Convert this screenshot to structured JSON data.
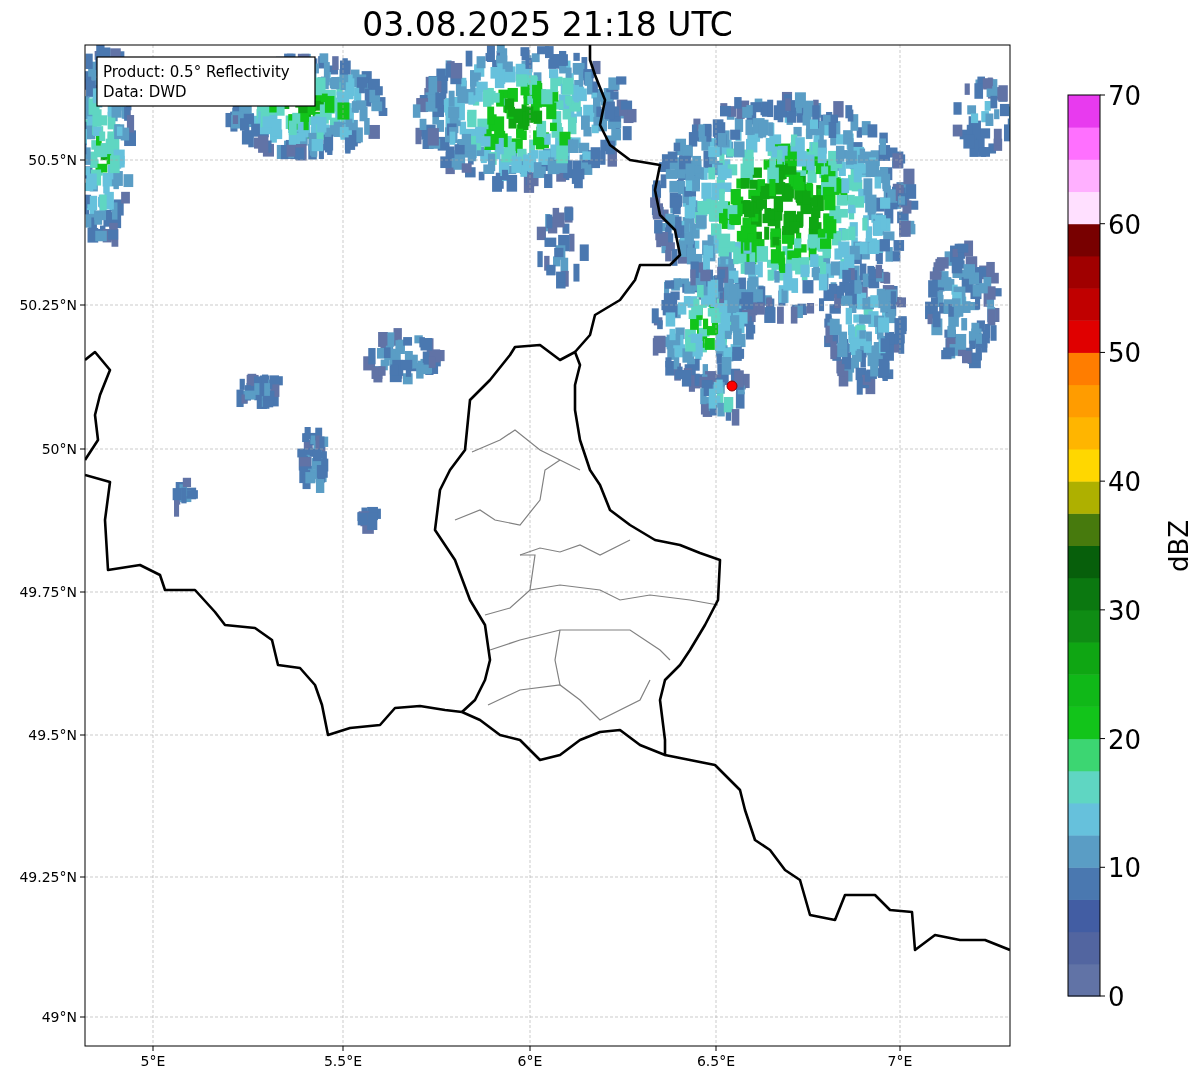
{
  "title": "03.08.2025 21:18 UTC",
  "info_box": [
    "Product: 0.5° Reflectivity",
    "Data: DWD"
  ],
  "lat_labels": [
    "50.5°N",
    "50.25°N",
    "50°N",
    "49.75°N",
    "49.5°N",
    "49.25°N",
    "49°N"
  ],
  "lon_labels": [
    "5°E",
    "5.5°E",
    "6°E",
    "6.5°E",
    "7°E"
  ],
  "colorbar": {
    "label": "dBZ",
    "ticks": [
      "70",
      "60",
      "50",
      "40",
      "30",
      "20",
      "10",
      "0"
    ],
    "segments": [
      {
        "color": "#6173a6"
      },
      {
        "color": "#5265a0"
      },
      {
        "color": "#425da3"
      },
      {
        "color": "#4a78b0"
      },
      {
        "color": "#5a9dc5"
      },
      {
        "color": "#66c1dc"
      },
      {
        "color": "#5fd6c2"
      },
      {
        "color": "#3cd672"
      },
      {
        "color": "#12c41a"
      },
      {
        "color": "#10b818"
      },
      {
        "color": "#0fa613"
      },
      {
        "color": "#0f8c14"
      },
      {
        "color": "#0b7810"
      },
      {
        "color": "#075f0b"
      },
      {
        "color": "#477a0d"
      },
      {
        "color": "#aeb000"
      },
      {
        "color": "#ffd700"
      },
      {
        "color": "#ffb500"
      },
      {
        "color": "#ff9c00"
      },
      {
        "color": "#ff7d00"
      },
      {
        "color": "#e00000"
      },
      {
        "color": "#c00000"
      },
      {
        "color": "#a00000"
      },
      {
        "color": "#780000"
      },
      {
        "color": "#ffe0ff"
      },
      {
        "color": "#ffb0ff"
      },
      {
        "color": "#ff70ff"
      },
      {
        "color": "#e83aef"
      }
    ]
  }
}
